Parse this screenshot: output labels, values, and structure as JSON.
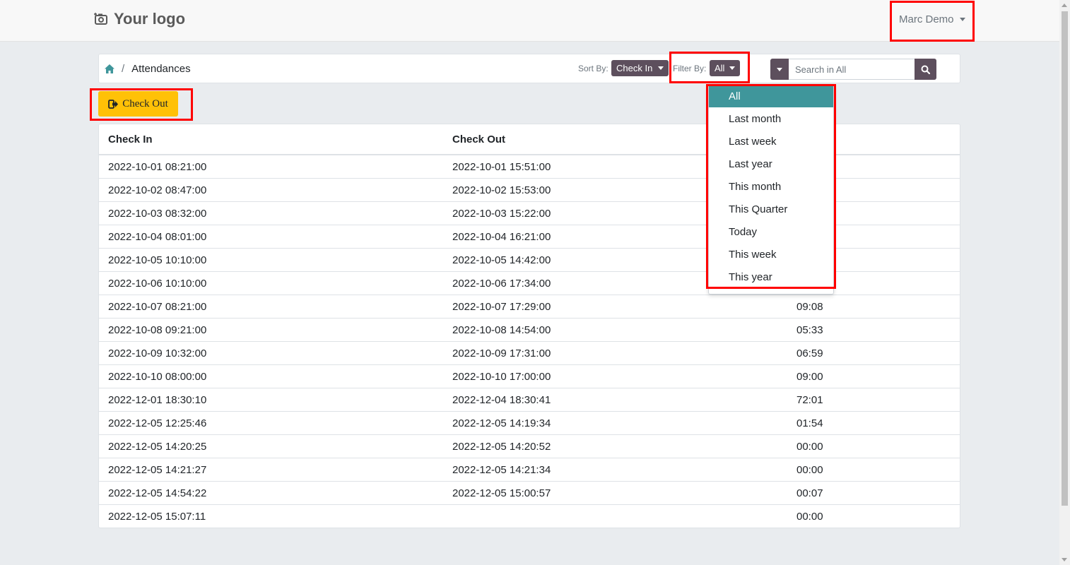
{
  "header": {
    "logo_text": "Your logo",
    "user_name": "Marc Demo"
  },
  "breadcrumb": {
    "separator": "/",
    "current": "Attendances"
  },
  "toolbar": {
    "sort_label": "Sort By:",
    "sort_value": "Check In",
    "filter_label": "Filter By:",
    "filter_value": "All",
    "search_placeholder": "Search in All"
  },
  "actions": {
    "checkout_label": "Check Out"
  },
  "table": {
    "columns": [
      "Check In",
      "Check Out",
      ""
    ],
    "rows": [
      [
        "2022-10-01 08:21:00",
        "2022-10-01 15:51:00",
        ""
      ],
      [
        "2022-10-02 08:47:00",
        "2022-10-02 15:53:00",
        ""
      ],
      [
        "2022-10-03 08:32:00",
        "2022-10-03 15:22:00",
        ""
      ],
      [
        "2022-10-04 08:01:00",
        "2022-10-04 16:21:00",
        ""
      ],
      [
        "2022-10-05 10:10:00",
        "2022-10-05 14:42:00",
        ""
      ],
      [
        "2022-10-06 10:10:00",
        "2022-10-06 17:34:00",
        ""
      ],
      [
        "2022-10-07 08:21:00",
        "2022-10-07 17:29:00",
        "09:08"
      ],
      [
        "2022-10-08 09:21:00",
        "2022-10-08 14:54:00",
        "05:33"
      ],
      [
        "2022-10-09 10:32:00",
        "2022-10-09 17:31:00",
        "06:59"
      ],
      [
        "2022-10-10 08:00:00",
        "2022-10-10 17:00:00",
        "09:00"
      ],
      [
        "2022-12-01 18:30:10",
        "2022-12-04 18:30:41",
        "72:01"
      ],
      [
        "2022-12-05 12:25:46",
        "2022-12-05 14:19:34",
        "01:54"
      ],
      [
        "2022-12-05 14:20:25",
        "2022-12-05 14:20:52",
        "00:00"
      ],
      [
        "2022-12-05 14:21:27",
        "2022-12-05 14:21:34",
        "00:00"
      ],
      [
        "2022-12-05 14:54:22",
        "2022-12-05 15:00:57",
        "00:07"
      ],
      [
        "2022-12-05 15:07:11",
        "",
        "00:00"
      ]
    ]
  },
  "filter_dropdown": {
    "items": [
      "All",
      "Last month",
      "Last week",
      "Last year",
      "This month",
      "This Quarter",
      "Today",
      "This week",
      "This year"
    ],
    "selected": "All"
  },
  "colors": {
    "primary": "#5d4f5d",
    "warning": "#ffc107",
    "active_item": "#3f969b",
    "highlight": "#ff0000",
    "home_icon": "#3f969b"
  }
}
